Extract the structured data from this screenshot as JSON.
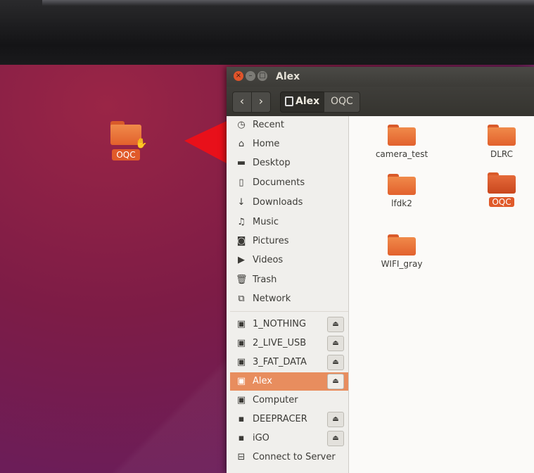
{
  "desktop": {
    "icon": {
      "label": "OQC",
      "icon": "folder-icon"
    }
  },
  "window": {
    "title": "Alex",
    "controls": {
      "close": "×",
      "minimize": "–",
      "maximize": "□"
    }
  },
  "toolbar": {
    "back": "‹",
    "forward": "›",
    "breadcrumbs": [
      "Alex",
      "OQC"
    ]
  },
  "sidebar": {
    "places": [
      {
        "label": "Recent",
        "icon": "clock-icon"
      },
      {
        "label": "Home",
        "icon": "home-icon"
      },
      {
        "label": "Desktop",
        "icon": "desktop-icon"
      },
      {
        "label": "Documents",
        "icon": "document-icon"
      },
      {
        "label": "Downloads",
        "icon": "download-icon"
      },
      {
        "label": "Music",
        "icon": "music-icon"
      },
      {
        "label": "Pictures",
        "icon": "camera-icon"
      },
      {
        "label": "Videos",
        "icon": "video-icon"
      },
      {
        "label": "Trash",
        "icon": "trash-icon"
      },
      {
        "label": "Network",
        "icon": "network-icon"
      }
    ],
    "devices": [
      {
        "label": "1_NOTHING",
        "eject": true
      },
      {
        "label": "2_LIVE_USB",
        "eject": true
      },
      {
        "label": "3_FAT_DATA",
        "eject": true
      },
      {
        "label": "Alex",
        "eject": true,
        "selected": true
      },
      {
        "label": "Computer",
        "eject": false
      },
      {
        "label": "DEEPRACER",
        "eject": true
      },
      {
        "label": "iGO",
        "eject": true
      },
      {
        "label": "Connect to Server",
        "eject": false
      }
    ]
  },
  "files": [
    {
      "name": "camera_test"
    },
    {
      "name": "DLRC"
    },
    {
      "name": "lfdk2"
    },
    {
      "name": "OQC",
      "selected": true
    },
    {
      "name": "WIFI_gray"
    }
  ],
  "colors": {
    "accent": "#e05a2a",
    "arrow": "#e8101a",
    "selection": "#e88d5e"
  }
}
